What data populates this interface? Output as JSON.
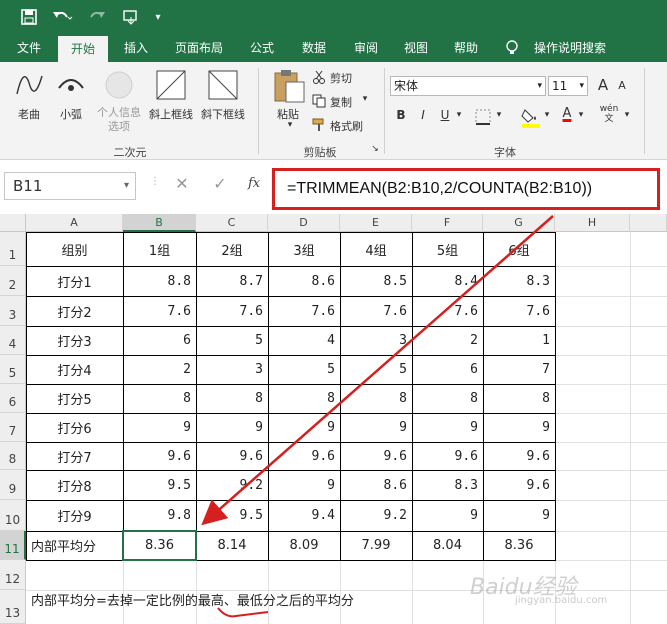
{
  "quick_access": {
    "save_icon": "save-icon",
    "undo_icon": "undo-icon",
    "redo_icon": "redo-icon",
    "touch_icon": "touch-mode-icon",
    "customize_icon": "chevron-down-icon"
  },
  "tabs": [
    "文件",
    "开始",
    "插入",
    "页面布局",
    "公式",
    "数据",
    "审阅",
    "视图",
    "帮助",
    "操作说明搜索"
  ],
  "active_tab": "开始",
  "ribbon": {
    "shapes": [
      {
        "label": "老曲",
        "icon": "curve-icon"
      },
      {
        "label": "小弧",
        "icon": "arc-icon"
      },
      {
        "label": "个人信息\n选项",
        "icon": "circle-icon"
      },
      {
        "label": "斜上框线",
        "icon": "diag-up-border-icon"
      },
      {
        "label": "斜下框线",
        "icon": "diag-down-border-icon"
      }
    ],
    "group1_label": "二次元",
    "paste_label": "粘贴",
    "cut_label": "剪切",
    "copy_label": "复制",
    "format_painter_label": "格式刷",
    "clipboard_label": "剪贴板",
    "font_name": "宋体",
    "font_size": "11",
    "grow_font": "A",
    "shrink_font": "A",
    "bold": "B",
    "italic": "I",
    "underline": "U",
    "font_color_letter": "A",
    "wen_label": "wén\n文",
    "font_group_label": "字体",
    "fill_color": "#ffff00",
    "font_color": "#ff0000"
  },
  "formula_bar": {
    "name_box": "B11",
    "fx": "fx",
    "formula": "=TRIMMEAN(B2:B10,2/COUNTA(B2:B10))"
  },
  "columns": [
    "A",
    "B",
    "C",
    "D",
    "E",
    "F",
    "G",
    "H"
  ],
  "rows": [
    "1",
    "2",
    "3",
    "4",
    "5",
    "6",
    "7",
    "8",
    "9",
    "10",
    "11",
    "12",
    "13"
  ],
  "table": {
    "header": [
      "组别",
      "1组",
      "2组",
      "3组",
      "4组",
      "5组",
      "6组"
    ],
    "rows": [
      [
        "打分1",
        "8.8",
        "8.7",
        "8.6",
        "8.5",
        "8.4",
        "8.3"
      ],
      [
        "打分2",
        "7.6",
        "7.6",
        "7.6",
        "7.6",
        "7.6",
        "7.6"
      ],
      [
        "打分3",
        "6",
        "5",
        "4",
        "3",
        "2",
        "1"
      ],
      [
        "打分4",
        "2",
        "3",
        "5",
        "5",
        "6",
        "7"
      ],
      [
        "打分5",
        "8",
        "8",
        "8",
        "8",
        "8",
        "8"
      ],
      [
        "打分6",
        "9",
        "9",
        "9",
        "9",
        "9",
        "9"
      ],
      [
        "打分7",
        "9.6",
        "9.6",
        "9.6",
        "9.6",
        "9.6",
        "9.6"
      ],
      [
        "打分8",
        "9.5",
        "9.2",
        "9",
        "8.6",
        "8.3",
        "9.6"
      ],
      [
        "打分9",
        "9.8",
        "9.5",
        "9.4",
        "9.2",
        "9",
        "9"
      ]
    ],
    "result": [
      "内部平均分",
      "8.36",
      "8.14",
      "8.09",
      "7.99",
      "8.04",
      "8.36"
    ]
  },
  "note": "内部平均分=去掉一定比例的最高、最低分之后的平均分",
  "watermark": "Baidu经验",
  "watermark_sub": "jingyan.baidu.com",
  "accent": "#217346",
  "annotation_color": "#d61f1f"
}
